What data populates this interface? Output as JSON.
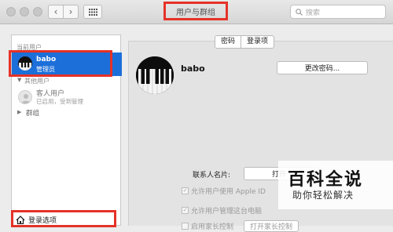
{
  "window": {
    "title": "用户与群组"
  },
  "search": {
    "placeholder": "搜索"
  },
  "sidebar": {
    "current_label": "当前用户",
    "current_user": {
      "name": "babo",
      "role": "管理员"
    },
    "other_label": "其他用户",
    "guest": {
      "name": "客人用户",
      "status": "已启用，受到管理"
    },
    "groups_label": "群组",
    "login_options": "登录选项"
  },
  "tabs": {
    "password": "密码",
    "login_items": "登录项"
  },
  "profile": {
    "name": "babo",
    "change_password": "更改密码..."
  },
  "contact": {
    "label": "联系人名片:",
    "open": "打开"
  },
  "options": [
    {
      "label": "允许用户使用 Apple ID"
    },
    {
      "label": "允许用户管理这台电脑"
    },
    {
      "label": "启用家长控制"
    }
  ],
  "parental": {
    "open": "打开家长控制"
  },
  "watermark": {
    "title": "百科全说",
    "subtitle": "助你轻松解决"
  }
}
